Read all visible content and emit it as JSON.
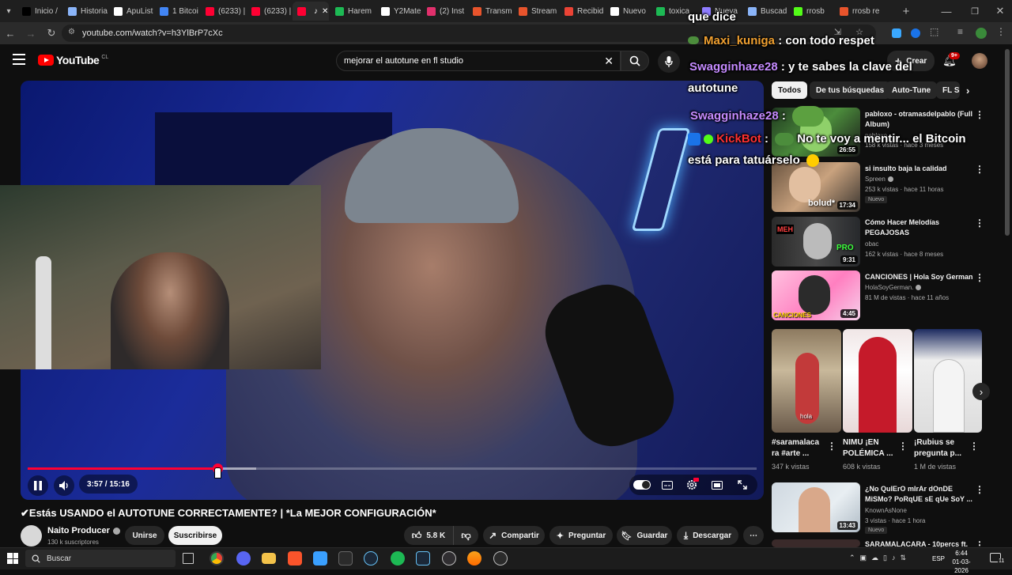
{
  "colors": {
    "accent": "#ff0033",
    "background": "#0f0f0f",
    "chip_bg": "#272727"
  },
  "browser": {
    "tabs": [
      {
        "label": "Inicio /",
        "icon": "x-icon",
        "color": "#000000",
        "active": false
      },
      {
        "label": "Historia",
        "icon": "document-icon",
        "color": "#8ab4f8",
        "active": false
      },
      {
        "label": "ApuList",
        "icon": "apulist-icon",
        "color": "#ffffff",
        "active": false
      },
      {
        "label": "1 Bitcoi",
        "icon": "google-icon",
        "color": "#4285f4",
        "active": false
      },
      {
        "label": "(6233) |",
        "icon": "youtube-icon",
        "color": "#ff0033",
        "active": false
      },
      {
        "label": "(6233) |",
        "icon": "youtube-icon",
        "color": "#ff0033",
        "active": false
      },
      {
        "label": "",
        "icon": "youtube-icon",
        "color": "#ff0033",
        "active": true
      },
      {
        "label": "Harem",
        "icon": "spotify-icon",
        "color": "#1db954",
        "active": false
      },
      {
        "label": "Y2Mate",
        "icon": "y2mate-icon",
        "color": "#ffffff",
        "active": false
      },
      {
        "label": "(2) Inst",
        "icon": "instagram-icon",
        "color": "#e1306c",
        "active": false
      },
      {
        "label": "Transmi",
        "icon": "stream-icon",
        "color": "#e8542c",
        "active": false
      },
      {
        "label": "Stream",
        "icon": "stream-icon",
        "color": "#e8542c",
        "active": false
      },
      {
        "label": "Recibid",
        "icon": "gmail-icon",
        "color": "#ea4335",
        "active": false
      },
      {
        "label": "Nuevo",
        "icon": "chatgpt-icon",
        "color": "#ffffff",
        "active": false
      },
      {
        "label": "toxica",
        "icon": "spotify-icon",
        "color": "#1db954",
        "active": false
      },
      {
        "label": "Nueva",
        "icon": "app-icon",
        "color": "#8e7cff",
        "active": false
      },
      {
        "label": "Buscad",
        "icon": "app-icon",
        "color": "#8ab4f8",
        "active": false
      },
      {
        "label": "rrosb",
        "icon": "kick-icon",
        "color": "#53fc18",
        "active": false
      },
      {
        "label": "rrosb re",
        "icon": "stream-icon",
        "color": "#e8542c",
        "active": false
      }
    ],
    "url": "youtube.com/watch?v=h3YlBrP7cXc"
  },
  "youtube": {
    "logo_text": "YouTube",
    "country": "CL",
    "search_value": "mejorar el autotune en fl studio",
    "create_label": "Crear",
    "notif_count": "9+"
  },
  "player": {
    "time_current": "3:57",
    "time_separator": " / ",
    "time_total": "15:16",
    "progress_played": 0.26,
    "progress_loaded": 0.313,
    "autoplay": true
  },
  "video": {
    "title": "✔Estás USANDO el AUTOTUNE CORRECTAMENTE? | *La MEJOR CONFIGURACIÓN*",
    "channel_name": "Naito Producer",
    "subscribers": "130 k suscriptores",
    "join_label": "Unirse",
    "subscribe_label": "Suscribirse",
    "likes": "5.8 K",
    "share_label": "Compartir",
    "ask_label": "Preguntar",
    "save_label": "Guardar",
    "download_label": "Descargar"
  },
  "chips": [
    "Todos",
    "De tus búsquedas",
    "Auto-Tune",
    "FL S"
  ],
  "related": [
    {
      "title1": "pabloxo - otramasdelpablo (Full",
      "title2": "Album)",
      "channel": "pabloxo",
      "meta": "158 k vistas · hace 3 meses",
      "duration": "26:55",
      "badge": ""
    },
    {
      "title1": "si insulto baja la calidad",
      "title2": "",
      "channel": "Spreen",
      "meta": "253 k vistas · hace 11 horas",
      "duration": "17:34",
      "badge": "Nuevo"
    },
    {
      "title1": "Cómo Hacer Melodías",
      "title2": "PEGAJOSAS",
      "channel": "obac",
      "meta": "162 k vistas · hace 8 meses",
      "duration": "9:31",
      "badge": ""
    },
    {
      "title1": "CANCIONES | Hola Soy German",
      "title2": "",
      "channel": "HolaSoyGerman.",
      "meta": "81 M de vistas · hace 11 años",
      "duration": "4:45",
      "badge": ""
    },
    {
      "title1": "¿No QuIErO mIrAr dOnDE",
      "title2": "MiSMo? PoRqUE sE qUe SoY ...",
      "channel": "KnownAsNone",
      "meta": "3 vistas · hace 1 hora",
      "duration": "13:43",
      "badge": "Nuevo"
    },
    {
      "title1": "SARAMALACARA - 10percs ft.",
      "title2": "",
      "channel": "",
      "meta": "",
      "duration": "",
      "badge": ""
    }
  ],
  "thumb_texts": {
    "r2": "bolud*",
    "r3_a": "MEH",
    "r3_b": "PRO",
    "r4": "CANCIONES",
    "s1": "hola"
  },
  "shorts": [
    {
      "title1": "#saramalaca",
      "title2": "ra #arte ...",
      "views": "347 k vistas"
    },
    {
      "title1": "NIMU ¡EN",
      "title2": "POLÉMICA ...",
      "views": "608 k vistas"
    },
    {
      "title1": "¡Rubius se",
      "title2": "pregunta p...",
      "views": "1 M de vistas"
    }
  ],
  "chat": {
    "line0": "que dice",
    "u1": "Maxi_kuniga",
    "m1": ": con todo respet",
    "u2": "Swagginhaze28",
    "m2": ": y te sabes la clave del",
    "m2b": "autotune",
    "u3": "Swagginhaze28",
    "m3": ":",
    "u4": "KickBot",
    "m4a": ":",
    "m4": "No te voy a mentir... el Bitcoin",
    "m4b": "está para tatuárselo",
    "colors": {
      "maxi": "#f0a030",
      "swag": "#c58bff",
      "kickbot": "#ff3030"
    }
  },
  "taskbar": {
    "search_placeholder": "Buscar",
    "language": "ESP",
    "time": "6:44",
    "date": "01-03-2026",
    "notifications": "11"
  }
}
